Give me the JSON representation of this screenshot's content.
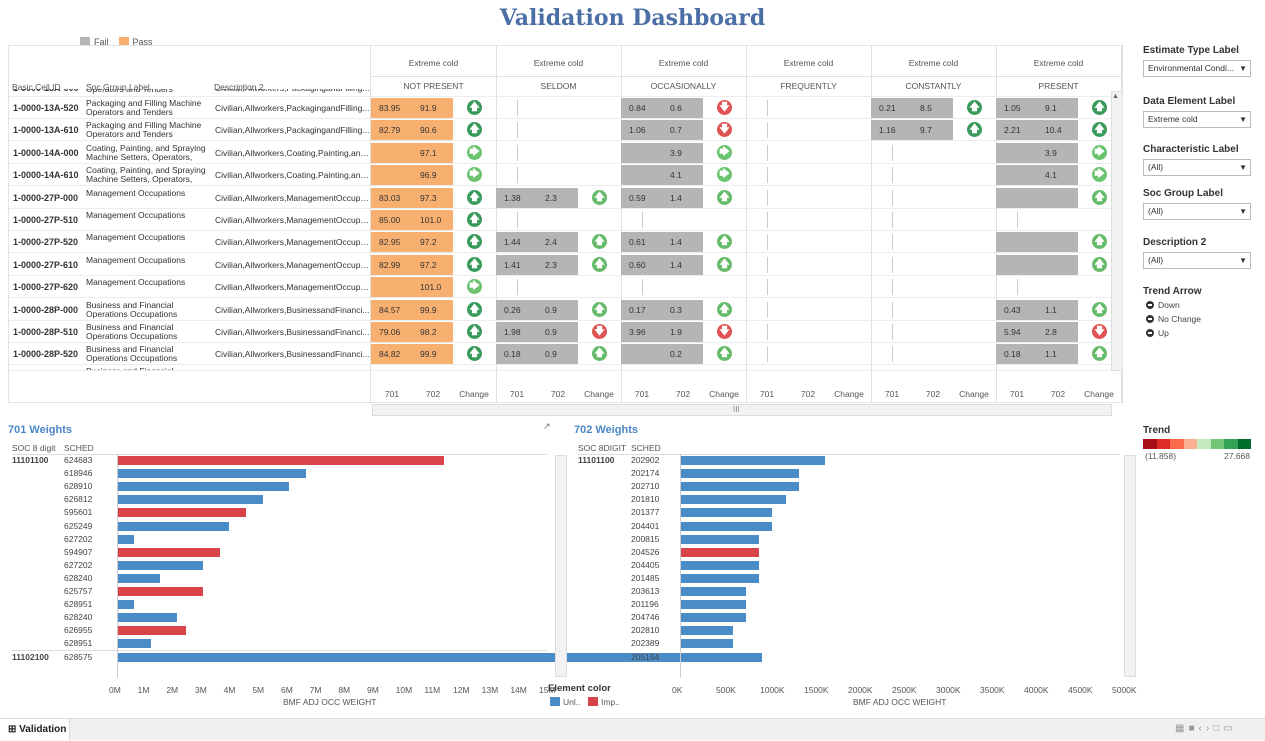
{
  "title": "Validation Dashboard",
  "legend": {
    "fail": "Fail",
    "pass": "Pass",
    "fail_color": "#b5b5b5",
    "pass_color": "#f8b071"
  },
  "table": {
    "col_headers": [
      "Basic Cell ID",
      "Soc Group Label",
      "Description 2"
    ],
    "group_top": [
      "Extreme cold",
      "Extreme cold",
      "Extreme cold",
      "Extreme cold",
      "Extreme cold",
      "Extreme cold"
    ],
    "group_sub": [
      "NOT PRESENT",
      "SELDOM",
      "OCCASIONALLY",
      "FREQUENTLY",
      "CONSTANTLY",
      "PRESENT"
    ],
    "bottom_headers": [
      "701",
      "702",
      "Change"
    ],
    "partial_row": {
      "id": "1-0000-13A-000",
      "grp": "Operators and Tenders",
      "desc": "Civilian,Allworkers,PackagingandFilling..."
    },
    "rows": [
      {
        "id": "1-0000-13A-520",
        "grp": "Packaging and Filling Machine Operators and Tenders",
        "desc": "Civilian,Allworkers,PackagingandFilling...",
        "g": [
          {
            "a": "83.95",
            "b": "91.9",
            "ar": "up",
            "f": "pass"
          },
          null,
          {
            "a": "0.84",
            "b": "0.6",
            "ar": "down",
            "f": "fail"
          },
          null,
          {
            "a": "0.21",
            "b": "8.5",
            "ar": "up",
            "f": "fail"
          },
          {
            "a": "1.05",
            "b": "9.1",
            "ar": "up",
            "f": "fail"
          }
        ]
      },
      {
        "id": "1-0000-13A-610",
        "grp": "Packaging and Filling Machine Operators and Tenders",
        "desc": "Civilian,Allworkers,PackagingandFilling...",
        "g": [
          {
            "a": "82.79",
            "b": "90.6",
            "ar": "up",
            "f": "pass"
          },
          null,
          {
            "a": "1.06",
            "b": "0.7",
            "ar": "down",
            "f": "fail"
          },
          null,
          {
            "a": "1.16",
            "b": "9.7",
            "ar": "up",
            "f": "fail"
          },
          {
            "a": "2.21",
            "b": "10.4",
            "ar": "up",
            "f": "fail"
          }
        ]
      },
      {
        "id": "1-0000-14A-000",
        "grp": "Coating, Painting, and Spraying Machine Setters, Operators, an...",
        "desc": "Civilian,Allworkers,Coating,Painting,and...",
        "g": [
          {
            "a": "",
            "b": "97.1",
            "ar": "right",
            "f": "pass"
          },
          null,
          {
            "a": "",
            "b": "3.9",
            "ar": "right",
            "f": "fail"
          },
          null,
          null,
          {
            "a": "",
            "b": "3.9",
            "ar": "right",
            "f": "fail"
          }
        ]
      },
      {
        "id": "1-0000-14A-610",
        "grp": "Coating, Painting, and Spraying Machine Setters, Operators, an...",
        "desc": "Civilian,Allworkers,Coating,Painting,and...",
        "g": [
          {
            "a": "",
            "b": "96.9",
            "ar": "right",
            "f": "pass"
          },
          null,
          {
            "a": "",
            "b": "4.1",
            "ar": "right",
            "f": "fail"
          },
          null,
          null,
          {
            "a": "",
            "b": "4.1",
            "ar": "right",
            "f": "fail"
          }
        ]
      },
      {
        "id": "1-0000-27P-000",
        "grp": "Management Occupations",
        "desc": "Civilian,Allworkers,ManagementOccupa...",
        "g": [
          {
            "a": "83.03",
            "b": "97.3",
            "ar": "up",
            "f": "pass"
          },
          {
            "a": "1.38",
            "b": "2.3",
            "ar": "up2",
            "f": "fail"
          },
          {
            "a": "0.59",
            "b": "1.4",
            "ar": "up2",
            "f": "fail"
          },
          null,
          null,
          {
            "a": "",
            "b": "",
            "ar": "up2",
            "f": "fail"
          }
        ]
      },
      {
        "id": "1-0000-27P-510",
        "grp": "Management Occupations",
        "desc": "Civilian,Allworkers,ManagementOccupa...",
        "g": [
          {
            "a": "85.00",
            "b": "101.0",
            "ar": "up",
            "f": "pass"
          },
          null,
          null,
          null,
          null,
          null
        ]
      },
      {
        "id": "1-0000-27P-520",
        "grp": "Management Occupations",
        "desc": "Civilian,Allworkers,ManagementOccupa...",
        "g": [
          {
            "a": "82.95",
            "b": "97.2",
            "ar": "up",
            "f": "pass"
          },
          {
            "a": "1.44",
            "b": "2.4",
            "ar": "up2",
            "f": "fail"
          },
          {
            "a": "0.61",
            "b": "1.4",
            "ar": "up2",
            "f": "fail"
          },
          null,
          null,
          {
            "a": "",
            "b": "",
            "ar": "up2",
            "f": "fail"
          }
        ]
      },
      {
        "id": "1-0000-27P-610",
        "grp": "Management Occupations",
        "desc": "Civilian,Allworkers,ManagementOccupa...",
        "g": [
          {
            "a": "82.99",
            "b": "97.2",
            "ar": "up",
            "f": "pass"
          },
          {
            "a": "1.41",
            "b": "2.3",
            "ar": "up2",
            "f": "fail"
          },
          {
            "a": "0.60",
            "b": "1.4",
            "ar": "up2",
            "f": "fail"
          },
          null,
          null,
          {
            "a": "",
            "b": "",
            "ar": "up2",
            "f": "fail"
          }
        ]
      },
      {
        "id": "1-0000-27P-620",
        "grp": "Management Occupations",
        "desc": "Civilian,Allworkers,ManagementOccupa...",
        "g": [
          {
            "a": "",
            "b": "101.0",
            "ar": "right",
            "f": "pass"
          },
          null,
          null,
          null,
          null,
          null
        ]
      },
      {
        "id": "1-0000-28P-000",
        "grp": "Business and Financial Operations Occupations",
        "desc": "Civilian,Allworkers,BusinessandFinanci...",
        "g": [
          {
            "a": "84.57",
            "b": "99.9",
            "ar": "up",
            "f": "pass"
          },
          {
            "a": "0.26",
            "b": "0.9",
            "ar": "up2",
            "f": "fail"
          },
          {
            "a": "0.17",
            "b": "0.3",
            "ar": "up2",
            "f": "fail"
          },
          null,
          null,
          {
            "a": "0.43",
            "b": "1.1",
            "ar": "up2",
            "f": "fail"
          }
        ]
      },
      {
        "id": "1-0000-28P-510",
        "grp": "Business and Financial Operations Occupations",
        "desc": "Civilian,Allworkers,BusinessandFinanci...",
        "g": [
          {
            "a": "79.06",
            "b": "98.2",
            "ar": "up",
            "f": "pass"
          },
          {
            "a": "1.98",
            "b": "0.9",
            "ar": "down",
            "f": "fail"
          },
          {
            "a": "3.96",
            "b": "1.9",
            "ar": "down",
            "f": "fail"
          },
          null,
          null,
          {
            "a": "5.94",
            "b": "2.8",
            "ar": "down",
            "f": "fail"
          }
        ]
      },
      {
        "id": "1-0000-28P-520",
        "grp": "Business and Financial Operations Occupations",
        "desc": "Civilian,Allworkers,BusinessandFinanci...",
        "g": [
          {
            "a": "84.82",
            "b": "99.9",
            "ar": "up",
            "f": "pass"
          },
          {
            "a": "0.18",
            "b": "0.9",
            "ar": "up2",
            "f": "fail"
          },
          {
            "a": "",
            "b": "0.2",
            "ar": "up2",
            "f": "fail"
          },
          null,
          null,
          {
            "a": "0.18",
            "b": "1.1",
            "ar": "up2",
            "f": "fail"
          }
        ]
      }
    ],
    "last_row": {
      "id": "1-0000-28P-610",
      "grp": "Business and Financial",
      "desc": "Civilian,Allworkers,BusinessandFinanci..."
    },
    "scroll_mid": "III"
  },
  "filters": [
    {
      "label": "Estimate Type Label",
      "value": "Environmental Condi..."
    },
    {
      "label": "Data Element Label",
      "value": "Extreme cold"
    },
    {
      "label": "Characteristic Label",
      "value": "(All)"
    },
    {
      "label": "Soc Group Label",
      "value": "(All)"
    },
    {
      "label": "Description 2",
      "value": "(All)"
    }
  ],
  "trend_arrow": {
    "label": "Trend Arrow",
    "options": [
      "Down",
      "No Change",
      "Up"
    ]
  },
  "trend": {
    "label": "Trend",
    "min": "(11.858)",
    "max": "27.668",
    "colors": [
      "#a50f15",
      "#de2d26",
      "#fb6a4a",
      "#fcae91",
      "#c7e9c0",
      "#74c476",
      "#31a354",
      "#006d2c"
    ]
  },
  "w701": {
    "title": "701 Weights",
    "h1": "SOC 8 digit",
    "h2": "SCHED",
    "group1": "11101100",
    "group2": "11102100",
    "rows": [
      {
        "s": "624683",
        "v": 0.38,
        "c": "imp"
      },
      {
        "s": "618946",
        "v": 0.22,
        "c": "unl"
      },
      {
        "s": "628910",
        "v": 0.2,
        "c": "unl"
      },
      {
        "s": "626812",
        "v": 0.17,
        "c": "unl"
      },
      {
        "s": "595601",
        "v": 0.15,
        "c": "imp"
      },
      {
        "s": "625249",
        "v": 0.13,
        "c": "unl"
      },
      {
        "s": "627202",
        "v": 0.02,
        "c": "unl"
      },
      {
        "s": "594907",
        "v": 0.12,
        "c": "imp"
      },
      {
        "s": "627202",
        "v": 0.1,
        "c": "unl"
      },
      {
        "s": "628240",
        "v": 0.05,
        "c": "unl"
      },
      {
        "s": "625757",
        "v": 0.1,
        "c": "imp"
      },
      {
        "s": "628951",
        "v": 0.02,
        "c": "unl"
      },
      {
        "s": "628240",
        "v": 0.07,
        "c": "unl"
      },
      {
        "s": "626955",
        "v": 0.08,
        "c": "imp"
      },
      {
        "s": "628951",
        "v": 0.04,
        "c": "unl"
      },
      {
        "s": "628575",
        "v": 0.75,
        "c": "unl"
      }
    ],
    "axis": [
      "0M",
      "1M",
      "2M",
      "3M",
      "4M",
      "5M",
      "6M",
      "7M",
      "8M",
      "9M",
      "10M",
      "11M",
      "12M",
      "13M",
      "14M",
      "15M"
    ],
    "xlabel": "BMF ADJ OCC WEIGHT"
  },
  "w702": {
    "title": "702 Weights",
    "h1": "SOC 8DIGIT",
    "h2": "SCHED",
    "group1": "11101100",
    "rows": [
      {
        "s": "202902",
        "v": 0.11,
        "c": "unl"
      },
      {
        "s": "202174",
        "v": 0.09,
        "c": "unl"
      },
      {
        "s": "202710",
        "v": 0.09,
        "c": "unl"
      },
      {
        "s": "201810",
        "v": 0.08,
        "c": "unl"
      },
      {
        "s": "201377",
        "v": 0.07,
        "c": "unl"
      },
      {
        "s": "204401",
        "v": 0.07,
        "c": "unl"
      },
      {
        "s": "200815",
        "v": 0.06,
        "c": "unl"
      },
      {
        "s": "204526",
        "v": 0.06,
        "c": "imp"
      },
      {
        "s": "204405",
        "v": 0.06,
        "c": "unl"
      },
      {
        "s": "201485",
        "v": 0.06,
        "c": "unl"
      },
      {
        "s": "203613",
        "v": 0.05,
        "c": "unl"
      },
      {
        "s": "201196",
        "v": 0.05,
        "c": "unl"
      },
      {
        "s": "204746",
        "v": 0.05,
        "c": "unl"
      },
      {
        "s": "202810",
        "v": 0.04,
        "c": "unl"
      },
      {
        "s": "202389",
        "v": 0.04,
        "c": "unl"
      },
      {
        "s": "205154",
        "v": 0.03,
        "c": "unl"
      }
    ],
    "axis": [
      "0K",
      "500K",
      "1000K",
      "1500K",
      "2000K",
      "2500K",
      "3000K",
      "3500K",
      "4000K",
      "4500K",
      "5000K"
    ],
    "xlabel": "BMF ADJ OCC WEIGHT"
  },
  "element_color": {
    "label": "Element color",
    "unl": "Unl..",
    "imp": "Imp..",
    "unl_color": "#4a8cc7",
    "imp_color": "#d9444b"
  },
  "tab": {
    "label": "Validation"
  }
}
